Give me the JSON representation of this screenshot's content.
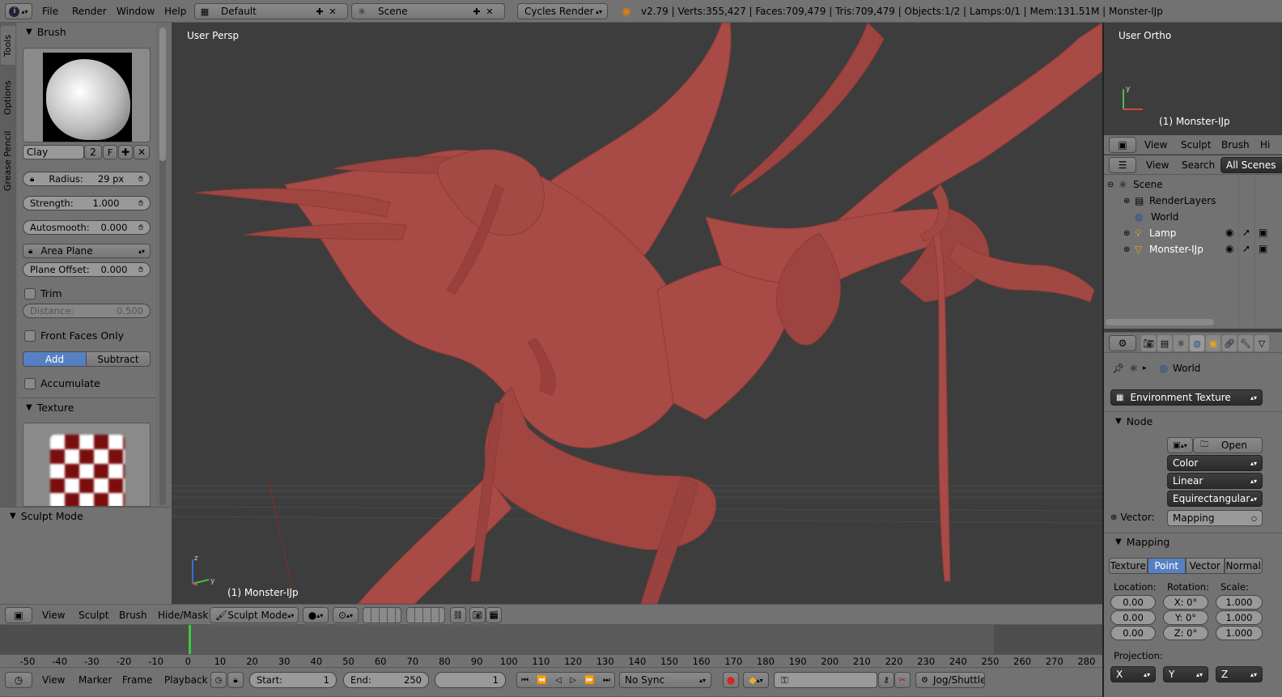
{
  "topbar": {
    "menus": [
      "File",
      "Render",
      "Window",
      "Help"
    ],
    "layout": "Default",
    "scene": "Scene",
    "engine": "Cycles Render",
    "stats": "v2.79 | Verts:355,427 | Faces:709,479 | Tris:709,479 | Objects:1/2 | Lamps:0/1 | Mem:131.51M | Monster-IJp"
  },
  "tool_tabs": [
    "Tools",
    "Options",
    "Grease Pencil"
  ],
  "brush_panel": {
    "title": "Brush",
    "brush_name": "Clay",
    "brush_users": "2",
    "fake_user": "F",
    "radius_label": "Radius:",
    "radius_value": "29 px",
    "strength_label": "Strength:",
    "strength_value": "1.000",
    "autosmooth_label": "Autosmooth:",
    "autosmooth_value": "0.000",
    "area_plane": "Area Plane",
    "plane_offset_label": "Plane Offset:",
    "plane_offset_value": "0.000",
    "trim_label": "Trim",
    "distance_label": "Distance:",
    "distance_value": "0.500",
    "front_faces_label": "Front Faces Only",
    "add_label": "Add",
    "subtract_label": "Subtract",
    "accumulate_label": "Accumulate",
    "texture_title": "Texture"
  },
  "sculpt_mode_panel": {
    "title": "Sculpt Mode"
  },
  "viewport": {
    "view_label": "User Persp",
    "object_label": "(1) Monster-IJp",
    "header_menus": [
      "View",
      "Sculpt",
      "Brush",
      "Hide/Mask"
    ],
    "mode": "Sculpt Mode"
  },
  "mini_view": {
    "view_label": "User Ortho",
    "object_label": "(1) Monster-IJp",
    "menus": [
      "View",
      "Sculpt",
      "Brush",
      "Hi"
    ]
  },
  "outliner": {
    "menus": [
      "View",
      "Search"
    ],
    "scope": "All Scenes",
    "items": [
      {
        "label": "Scene",
        "icon": "scene-icon"
      },
      {
        "label": "RenderLayers",
        "icon": "renderlayers-icon"
      },
      {
        "label": "World",
        "icon": "world-icon"
      },
      {
        "label": "Lamp",
        "icon": "lamp-icon"
      },
      {
        "label": "Monster-IJp",
        "icon": "mesh-icon"
      }
    ]
  },
  "properties": {
    "breadcrumb": "World",
    "env_texture": "Environment Texture",
    "node_title": "Node",
    "open_label": "Open",
    "color_space": "Color",
    "interp": "Linear",
    "projection_mode": "Equirectangular",
    "vector_label": "Vector:",
    "vector_value": "Mapping",
    "mapping_title": "Mapping",
    "mapping_tabs": [
      "Texture",
      "Point",
      "Vector",
      "Normal"
    ],
    "location_label": "Location:",
    "rotation_label": "Rotation:",
    "scale_label": "Scale:",
    "location": [
      "0.00",
      "0.00",
      "0.00"
    ],
    "rotation": [
      "X: 0°",
      "Y: 0°",
      "Z: 0°"
    ],
    "scale": [
      "1.000",
      "1.000",
      "1.000"
    ],
    "projection_label": "Projection:",
    "projection_axes": [
      "X",
      "Y",
      "Z"
    ]
  },
  "timeline": {
    "ticks": [
      "-50",
      "-40",
      "-30",
      "-20",
      "-10",
      "0",
      "10",
      "20",
      "30",
      "40",
      "50",
      "60",
      "70",
      "80",
      "90",
      "100",
      "110",
      "120",
      "130",
      "140",
      "150",
      "160",
      "170",
      "180",
      "190",
      "200",
      "210",
      "220",
      "230",
      "240",
      "250",
      "260",
      "270",
      "280"
    ],
    "menus": [
      "View",
      "Marker",
      "Frame",
      "Playback"
    ],
    "start_label": "Start:",
    "start_value": "1",
    "end_label": "End:",
    "end_value": "250",
    "current_frame": "1",
    "sync": "No Sync",
    "keying": "Jog/Shuttle"
  },
  "colors": {
    "accent": "#5680c2",
    "mesh": "#a84a45",
    "viewport_bg": "#3d3d3d",
    "panel": "#727272"
  }
}
